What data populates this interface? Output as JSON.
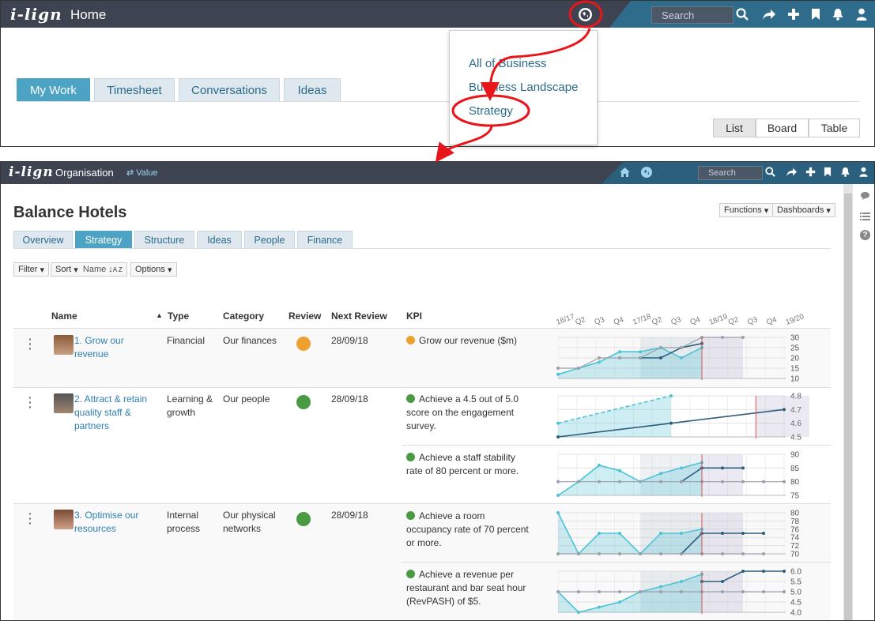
{
  "colors": {
    "topbar": "#3e4352",
    "accent": "#4da3c4",
    "link": "#2b7fb0",
    "annotation": "#e8161b",
    "orange": "#f0a030",
    "green": "#4a9a44"
  },
  "top": {
    "logo": "i-lign",
    "title": "Home",
    "search_placeholder": "Search",
    "icons": [
      "globe-icon",
      "search-icon",
      "share-icon",
      "plus-icon",
      "bookmark-icon",
      "bell-icon",
      "user-icon"
    ],
    "tabs": [
      "My Work",
      "Timesheet",
      "Conversations",
      "Ideas"
    ],
    "active_tab": "My Work",
    "dropdown": [
      "All of Business",
      "Business Landscape",
      "Strategy"
    ],
    "views": [
      "List",
      "Board",
      "Table"
    ],
    "active_view": "List"
  },
  "bottom": {
    "logo": "i-lign",
    "context": "Organisation",
    "value_toggle": "Value",
    "search_placeholder": "Search",
    "icons": [
      "home-icon",
      "globe-icon",
      "search-icon",
      "share-icon",
      "plus-icon",
      "bookmark-icon",
      "bell-icon",
      "user-icon"
    ],
    "page_title": "Balance Hotels",
    "functions_label": "Functions",
    "dashboards_label": "Dashboards",
    "tabs": [
      "Overview",
      "Strategy",
      "Structure",
      "Ideas",
      "People",
      "Finance"
    ],
    "active_tab": "Strategy",
    "toolbar": {
      "filter": "Filter",
      "sort": "Sort",
      "sort_field": "Name",
      "options": "Options"
    },
    "columns": [
      "Name",
      "Type",
      "Category",
      "Review",
      "Next Review",
      "KPI"
    ],
    "timeline_labels": [
      "16/17",
      "Q2",
      "Q3",
      "Q4",
      "17/18",
      "Q2",
      "Q3",
      "Q4",
      "18/19",
      "Q2",
      "Q3",
      "Q4",
      "19/20"
    ],
    "rows": [
      {
        "name": "1. Grow our revenue",
        "type": "Financial",
        "category": "Our finances",
        "review_color": "#f0a030",
        "next_review": "28/09/18",
        "kpis": [
          {
            "text": "Grow our revenue ($m)",
            "color": "#f0a030",
            "ticks": [
              "30",
              "25",
              "20",
              "15",
              "10"
            ]
          }
        ]
      },
      {
        "name": "2. Attract & retain quality staff & partners",
        "type": "Learning & growth",
        "category": "Our people",
        "review_color": "#4a9a44",
        "next_review": "28/09/18",
        "kpis": [
          {
            "text": "Achieve a 4.5 out of 5.0 score on the engagement survey.",
            "color": "#4a9a44",
            "ticks": [
              "4.8",
              "4.7",
              "4.6",
              "4.5"
            ]
          },
          {
            "text": "Achieve a staff stability rate of 80 percent or more.",
            "color": "#4a9a44",
            "ticks": [
              "90",
              "85",
              "80",
              "75"
            ]
          }
        ]
      },
      {
        "name": "3. Optimise our resources",
        "type": "Internal process",
        "category": "Our physical networks",
        "review_color": "#4a9a44",
        "next_review": "28/09/18",
        "kpis": [
          {
            "text": "Achieve a room occupancy rate of 70 percent or more.",
            "color": "#4a9a44",
            "ticks": [
              "80",
              "78",
              "76",
              "74",
              "72",
              "70"
            ]
          },
          {
            "text": "Achieve a revenue per restaurant and bar seat hour (RevPASH) of $5.",
            "color": "#4a9a44",
            "ticks": [
              "6.0",
              "5.5",
              "5.0",
              "4.5",
              "4.0"
            ]
          }
        ]
      }
    ],
    "side_icons": [
      "comment-icon",
      "list-icon",
      "help-icon"
    ]
  },
  "chart_data": [
    {
      "type": "line",
      "title": "Grow our revenue ($m)",
      "ylim": [
        10,
        30
      ],
      "x": [
        "16/17",
        "Q2",
        "Q3",
        "Q4",
        "17/18",
        "Q2",
        "Q3",
        "Q4",
        "18/19",
        "Q2"
      ],
      "series": [
        {
          "values": [
            12,
            15,
            18,
            23,
            23,
            25,
            20,
            25,
            null,
            null
          ]
        },
        {
          "values": [
            null,
            null,
            null,
            null,
            20,
            20,
            25,
            27,
            null,
            null
          ]
        },
        {
          "values": [
            15,
            15,
            20,
            20,
            20,
            25,
            25,
            30,
            30,
            30
          ]
        }
      ]
    },
    {
      "type": "line",
      "title": "Achieve a 4.5 out of 5.0 score on the engagement survey.",
      "ylim": [
        4.5,
        4.8
      ],
      "x": [
        "16/17",
        "17/18",
        "18/19"
      ],
      "series": [
        {
          "values": [
            4.6,
            4.8,
            null
          ]
        },
        {
          "values": [
            4.5,
            4.6,
            4.7
          ]
        }
      ]
    },
    {
      "type": "line",
      "title": "Achieve a staff stability rate of 80 percent or more.",
      "ylim": [
        75,
        90
      ],
      "x": [
        "16/17",
        "Q2",
        "Q3",
        "Q4",
        "17/18",
        "Q2",
        "Q3",
        "Q4",
        "18/19",
        "Q2",
        "Q3",
        "Q4"
      ],
      "series": [
        {
          "values": [
            75,
            80,
            86,
            84,
            80,
            83,
            85,
            87,
            null,
            null,
            null,
            null
          ]
        },
        {
          "values": [
            null,
            null,
            null,
            null,
            null,
            null,
            80,
            85,
            85,
            85,
            null,
            null
          ]
        },
        {
          "values": [
            80,
            80,
            80,
            80,
            80,
            80,
            80,
            80,
            80,
            80,
            80,
            80
          ]
        }
      ]
    },
    {
      "type": "line",
      "title": "Achieve a room occupancy rate of 70 percent or more.",
      "ylim": [
        70,
        80
      ],
      "x": [
        "16/17",
        "Q2",
        "Q3",
        "Q4",
        "17/18",
        "Q2",
        "Q3",
        "Q4",
        "18/19",
        "Q2",
        "Q3"
      ],
      "series": [
        {
          "values": [
            80,
            70,
            75,
            75,
            70,
            75,
            75,
            76,
            null,
            null,
            null
          ]
        },
        {
          "values": [
            null,
            null,
            null,
            null,
            null,
            null,
            70,
            75,
            75,
            75,
            75
          ]
        },
        {
          "values": [
            70,
            70,
            70,
            70,
            70,
            70,
            70,
            70,
            70,
            70,
            70
          ]
        }
      ]
    },
    {
      "type": "line",
      "title": "Achieve a revenue per restaurant and bar seat hour (RevPASH) of $5.",
      "ylim": [
        4.0,
        6.0
      ],
      "x": [
        "16/17",
        "Q2",
        "Q3",
        "Q4",
        "17/18",
        "Q2",
        "Q3",
        "Q4",
        "18/19",
        "Q2",
        "Q3",
        "Q4"
      ],
      "series": [
        {
          "values": [
            5.0,
            4.0,
            4.25,
            4.5,
            5.0,
            5.25,
            5.5,
            5.85,
            null,
            null,
            null,
            null
          ]
        },
        {
          "values": [
            null,
            null,
            null,
            null,
            null,
            null,
            null,
            5.5,
            5.5,
            6.0,
            6.0,
            6.0
          ]
        },
        {
          "values": [
            5.0,
            5.0,
            5.0,
            5.0,
            5.0,
            5.0,
            5.0,
            5.0,
            5.0,
            5.0,
            5.0,
            5.0
          ]
        }
      ]
    }
  ]
}
